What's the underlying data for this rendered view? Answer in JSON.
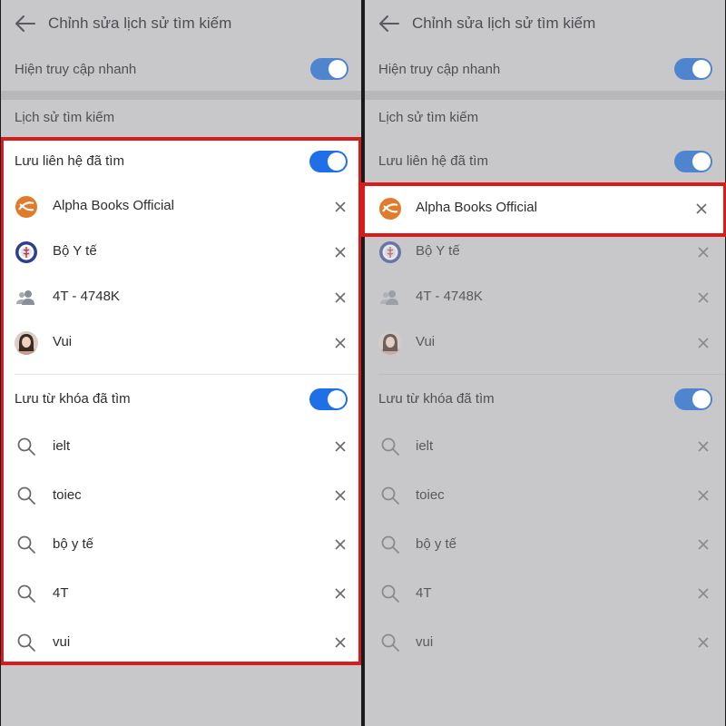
{
  "header": {
    "title": "Chỉnh sửa lịch sử tìm kiếm",
    "back_icon": "arrow-left-icon"
  },
  "quick_access": {
    "label": "Hiện truy cập nhanh",
    "enabled": true
  },
  "history_section": {
    "label": "Lịch sử tìm kiếm"
  },
  "contacts_toggle": {
    "label": "Lưu liên hệ đã tìm",
    "enabled": true
  },
  "contacts": [
    {
      "name": "Alpha Books Official",
      "avatar_icon": "alpha-books-logo-icon"
    },
    {
      "name": "Bộ Y tế",
      "avatar_icon": "ministry-of-health-logo-icon"
    },
    {
      "name": "4T - 4748K",
      "avatar_icon": "group-people-icon"
    },
    {
      "name": "Vui",
      "avatar_icon": "user-photo-avatar"
    }
  ],
  "keywords_toggle": {
    "label": "Lưu từ khóa đã tìm",
    "enabled": true
  },
  "keywords": [
    {
      "text": "ielt"
    },
    {
      "text": "toiec"
    },
    {
      "text": "bộ y tế"
    },
    {
      "text": "4T"
    },
    {
      "text": "vui"
    }
  ],
  "highlighted_contact": {
    "name": "Alpha Books Official"
  },
  "colors": {
    "toggle_on_active": "#1e6fe8",
    "toggle_on_dimmed": "#4f85cf",
    "highlight_border": "#d81b1b",
    "dim_background": "#c8c8cb"
  }
}
